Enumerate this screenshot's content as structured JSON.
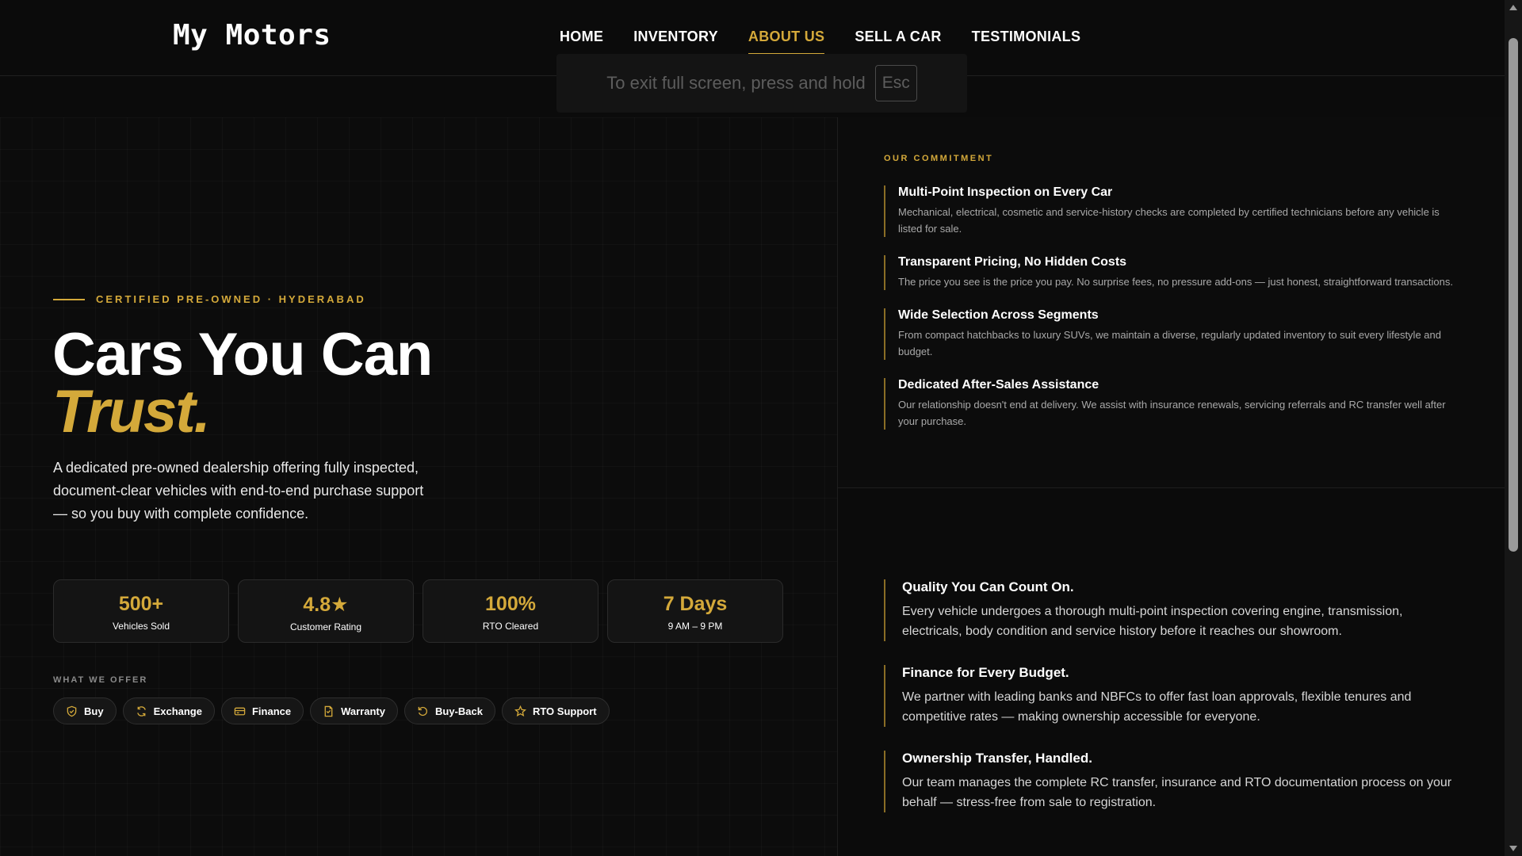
{
  "nav": {
    "logo": "My Motors",
    "items": [
      {
        "label": "HOME",
        "active": false
      },
      {
        "label": "INVENTORY",
        "active": false
      },
      {
        "label": "ABOUT US",
        "active": true
      },
      {
        "label": "SELL A CAR",
        "active": false
      },
      {
        "label": "TESTIMONIALS",
        "active": false
      }
    ]
  },
  "fullscreen_notice": {
    "text": "To exit full screen, press and hold",
    "key": "Esc"
  },
  "hero": {
    "eyebrow": "CERTIFIED PRE-OWNED · HYDERABAD",
    "headline_line1": "Cars You Can",
    "headline_line2": "Trust.",
    "description": "A dedicated pre-owned dealership offering fully inspected, document-clear vehicles with end-to-end purchase support — so you buy with complete confidence.",
    "stats": [
      {
        "value": "500+",
        "label": "Vehicles Sold"
      },
      {
        "value": "4.8★",
        "label": "Customer Rating"
      },
      {
        "value": "100%",
        "label": "RTO Cleared"
      },
      {
        "value": "7 Days",
        "label": "9 AM – 9 PM"
      }
    ],
    "offer_title": "WHAT WE OFFER",
    "offers": [
      {
        "label": "Buy",
        "icon": "shield-icon"
      },
      {
        "label": "Exchange",
        "icon": "refresh-icon"
      },
      {
        "label": "Finance",
        "icon": "card-icon"
      },
      {
        "label": "Warranty",
        "icon": "document-icon"
      },
      {
        "label": "Buy-Back",
        "icon": "undo-icon"
      },
      {
        "label": "RTO Support",
        "icon": "star-icon"
      }
    ]
  },
  "commitment": {
    "title": "OUR COMMITMENT",
    "items": [
      {
        "title": "Multi-Point Inspection on Every Car",
        "text": "Mechanical, electrical, cosmetic and service-history checks are completed by certified technicians before any vehicle is listed for sale."
      },
      {
        "title": "Transparent Pricing, No Hidden Costs",
        "text": "The price you see is the price you pay. No surprise fees, no pressure add-ons — just honest, straightforward transactions."
      },
      {
        "title": "Wide Selection Across Segments",
        "text": "From compact hatchbacks to luxury SUVs, we maintain a diverse, regularly updated inventory to suit every lifestyle and budget."
      },
      {
        "title": "Dedicated After-Sales Assistance",
        "text": "Our relationship doesn't end at delivery. We assist with insurance renewals, servicing referrals and RC transfer well after your purchase."
      }
    ]
  },
  "features": [
    {
      "title": "Quality You Can Count On.",
      "text": "Every vehicle undergoes a thorough multi-point inspection covering engine, transmission, electricals, body condition and service history before it reaches our showroom."
    },
    {
      "title": "Finance for Every Budget.",
      "text": "We partner with leading banks and NBFCs to offer fast loan approvals, flexible tenures and competitive rates — making ownership accessible for everyone."
    },
    {
      "title": "Ownership Transfer, Handled.",
      "text": "Our team manages the complete RC transfer, insurance and RTO documentation process on your behalf — stress-free from sale to registration."
    }
  ],
  "colors": {
    "accent": "#d4a93a",
    "background": "#0b0b0b"
  }
}
